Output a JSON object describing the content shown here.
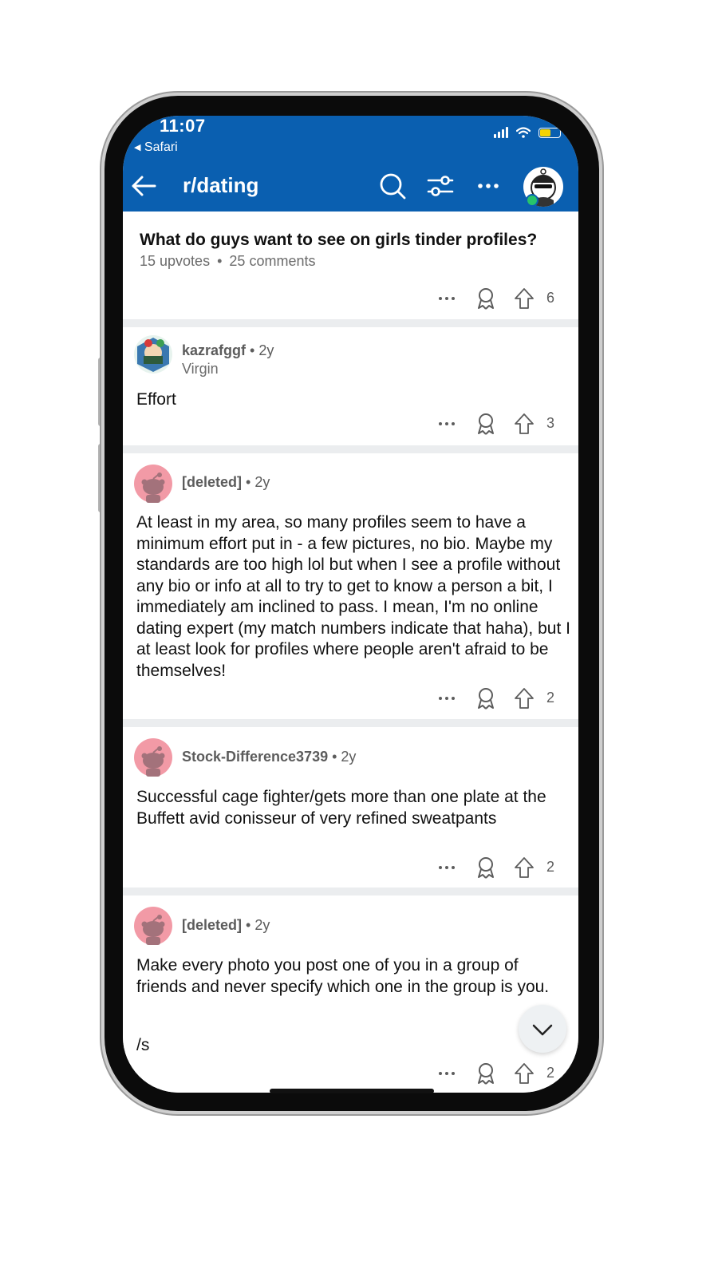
{
  "status_bar": {
    "time": "11:07",
    "back_app": "Safari",
    "battery_color": "#f5d400"
  },
  "nav": {
    "back_icon": "back-arrow-icon",
    "title": "r/dating",
    "icons": [
      "search-icon",
      "filter-icon",
      "more-icon"
    ]
  },
  "post": {
    "title": "What do guys want to see on girls tinder profiles?",
    "upvotes": "15 upvotes",
    "comments": "25 comments",
    "separator": "•",
    "vote_count": "6"
  },
  "comments": [
    {
      "user": "kazrafggf",
      "age": "• 2y",
      "flair": "Virgin",
      "body": "Effort",
      "votes": "3"
    },
    {
      "user": "[deleted]",
      "age": "• 2y",
      "flair": "",
      "body": "At least in my area, so many profiles seem to have a minimum effort put in - a few pictures, no bio. Maybe my standards are too high lol but when I see a profile without any bio or info at all to try to get to know a person a bit, I immediately am inclined to pass. I mean, I'm no online dating expert (my match numbers indicate that haha), but I at least look for profiles where people aren't afraid to be themselves!",
      "votes": "2"
    },
    {
      "user": "Stock-Difference3739",
      "age": "• 2y",
      "flair": "",
      "body": "Successful cage fighter/gets more than one plate at the Buffett avid conisseur of very refined sweatpants",
      "votes": "2"
    },
    {
      "user": "[deleted]",
      "age": "• 2y",
      "flair": "",
      "body": "Make every photo you post one of you in a group of friends and never specify which one in the group is you.",
      "body2": "/s",
      "votes": "2"
    }
  ],
  "colors": {
    "app_bar": "#0a5fb0",
    "default_avatar": "#f29aa6",
    "online": "#27c46b"
  }
}
